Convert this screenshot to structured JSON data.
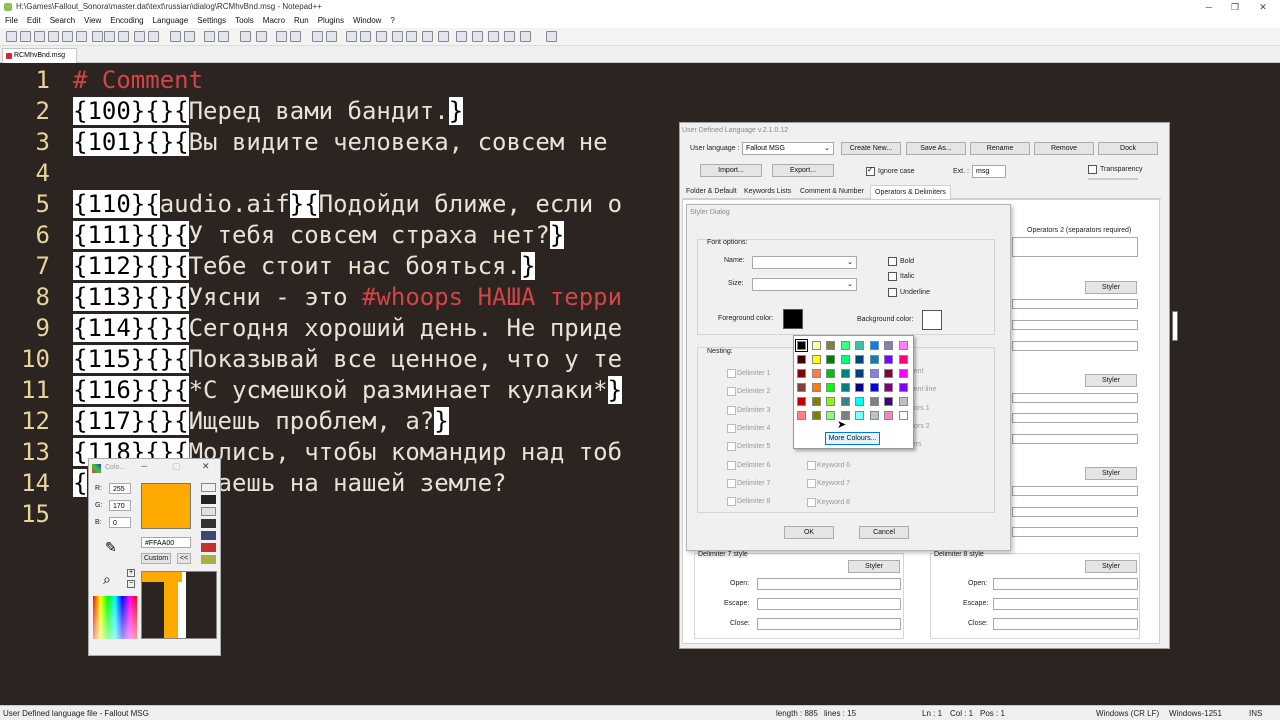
{
  "window": {
    "title": "H:\\Games\\Fallout_Sonora\\master.dat\\text\\russian\\dialog\\RCMhvBnd.msg - Notepad++"
  },
  "menu": [
    "File",
    "Edit",
    "Search",
    "View",
    "Encoding",
    "Language",
    "Settings",
    "Tools",
    "Macro",
    "Run",
    "Plugins",
    "Window",
    "?"
  ],
  "tab": {
    "label": "RCMhvBnd.msg"
  },
  "editor": {
    "line_numbers": [
      "1",
      "2",
      "3",
      "4",
      "5",
      "6",
      "7",
      "8",
      "9",
      "10",
      "11",
      "12",
      "13",
      "14",
      "15"
    ],
    "lines": [
      {
        "a": "# Comment"
      },
      {
        "a": "{100}{}{",
        "b": "Перед вами бандит.",
        "c": "}"
      },
      {
        "a": "{101}{}{",
        "b": "Вы видите человека, совсем не"
      },
      {},
      {
        "a": "{110}{",
        "m": "audio.aif",
        "a2": "}{",
        "b": "Подойди ближе, если о"
      },
      {
        "a": "{111}{}{",
        "b": "У тебя совсем страха нет?",
        "c": "}"
      },
      {
        "a": "{112}{}{",
        "b": "Тебе стоит нас бояться.",
        "c": "}"
      },
      {
        "a": "{113}{}{",
        "b": "Уясни - это ",
        "r": "#whoops НАША терри"
      },
      {
        "a": "{114}{}{",
        "b": "Сегодня хороший день. Не приде"
      },
      {
        "a": "{115}{}{",
        "b": "Показывай все ценное, что у те"
      },
      {
        "a": "{116}{}{",
        "b": "*С усмешкой разминает кулаки*",
        "c": "}"
      },
      {
        "a": "{117}{}{",
        "b": "Ищешь проблем, а?",
        "c": "}"
      },
      {
        "a": "{118}{}{",
        "b": "Молись, чтобы командир над тоб"
      },
      {
        "a": "{",
        "b": "то ты делаешь на нашей земле?"
      },
      {}
    ]
  },
  "status": {
    "file_type": "User Defined language file - Fallout MSG",
    "length": "length : 885",
    "lines": "lines : 15",
    "ln": "Ln : 1",
    "col": "Col : 1",
    "pos": "Pos : 1",
    "eol": "Windows (CR LF)",
    "encoding": "Windows-1251",
    "mode": "INS"
  },
  "udl": {
    "title": "User Defined Language v.2.1.0.12",
    "user_language_label": "User language :",
    "user_language_value": "Fallout MSG",
    "create_new": "Create New...",
    "save_as": "Save As...",
    "rename": "Rename",
    "remove": "Remove",
    "dock": "Dock",
    "import": "Import...",
    "export": "Export...",
    "ignore_case": "Ignore case",
    "ext_label": "Ext. :",
    "ext_value": "msg",
    "transparency": "Transparency",
    "tabs": [
      "Folder & Default",
      "Keywords Lists",
      "Comment & Number",
      "Operators & Delimiters"
    ],
    "operators2": "Operators 2 (separators required)",
    "styler": "Styler",
    "delim7": "Delimiter 7 style",
    "delim8": "Delimiter 8 style",
    "open": "Open:",
    "escape": "Escape:",
    "close": "Close:"
  },
  "styler": {
    "title": "Styler Dialog",
    "font_options": "Font options:",
    "name": "Name:",
    "size": "Size:",
    "bold": "Bold",
    "italic": "Italic",
    "underline": "Underline",
    "fg": "Foreground color:",
    "bg": "Background color:",
    "nesting": "Nesting:",
    "delims": [
      "Delimiter 1",
      "Delimiter 2",
      "Delimiter 3",
      "Delimiter 4",
      "Delimiter 5",
      "Delimiter 6",
      "Delimiter 7",
      "Delimiter 8"
    ],
    "right": [
      "mment",
      "mment line",
      "erators 1",
      "erators 2",
      "mbers"
    ],
    "kw": [
      "Keyword 6",
      "Keyword 7",
      "Keyword 8"
    ],
    "ok": "OK",
    "cancel": "Cancel",
    "more": "More Colours..."
  },
  "palette": [
    "#000000",
    "#ffffa0",
    "#808040",
    "#40ff80",
    "#40c0a0",
    "#0080ff",
    "#8080c0",
    "#ff80ff",
    "#400000",
    "#ffff00",
    "#008000",
    "#00ff80",
    "#004080",
    "#0080c0",
    "#8000ff",
    "#ff0080",
    "#800000",
    "#ff8040",
    "#00c000",
    "#008080",
    "#004080",
    "#8080ff",
    "#800040",
    "#ff00ff",
    "#804040",
    "#ff8000",
    "#00ff00",
    "#008080",
    "#000080",
    "#0000ff",
    "#800080",
    "#8000ff",
    "#c00000",
    "#808000",
    "#80ff00",
    "#408080",
    "#00ffff",
    "#808080",
    "#400080",
    "#c0c0c0",
    "#ff8080",
    "#808000",
    "#80ff80",
    "#808080",
    "#80ffff",
    "#c0c0c0",
    "#ff80c0",
    "#ffffff"
  ],
  "colpick": {
    "title": "Colo...",
    "r": "255",
    "g": "170",
    "b": "0",
    "hex": "#FFAA00",
    "custom": "Custom",
    "r_lbl": "R:",
    "g_lbl": "G:",
    "b_lbl": "B:",
    "back": "<<",
    "color": "#ffaa00"
  }
}
